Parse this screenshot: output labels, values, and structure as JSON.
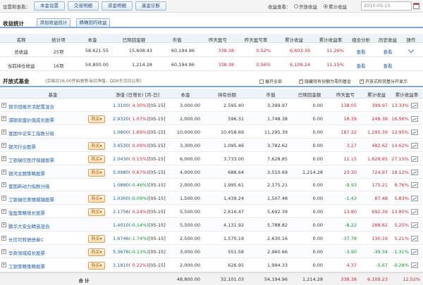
{
  "toolbar": {
    "settings_label": "设置和查看：",
    "buttons": [
      "本金设置",
      "交易明细",
      "资金明细",
      "基金诊断"
    ],
    "view_label": "收益查看：",
    "radio_open": "开放收益",
    "radio_total": "累计收益",
    "date": "2015-05-15"
  },
  "summary": {
    "title": "收益统计",
    "add_button": "添加收益统计",
    "fine_button": "精确到的收益",
    "headers": [
      "名称",
      "统计项",
      "本金",
      "已赎回金额",
      "市值",
      "昨天盈亏",
      "昨天盈亏率",
      "累计收益",
      "累计收益率",
      "组合分析",
      "历史收益",
      "操作"
    ],
    "rows": [
      {
        "name": "总收益",
        "count": "25项",
        "principal": "58,621.55",
        "redeemed": "15,608.43",
        "market": "60,194.96",
        "yday": "338.38",
        "yday_rate": "0.52%",
        "total": "6,603.39",
        "total_rate": "11.26%",
        "analysis": "查看",
        "history": "查看"
      },
      {
        "name": "当前持仓收益",
        "count": "16项",
        "principal": "54,800.00",
        "redeemed": "1,214.28",
        "market": "60,194.96",
        "yday": "338.38",
        "yday_rate": "0.56%",
        "total": "6,109.24",
        "total_rate": "11.15%",
        "analysis": "查看",
        "history": "查看"
      }
    ]
  },
  "funds": {
    "title": "开放式基金",
    "note": "(交易日16:00开始更新当日净值，QDII于次日公布)",
    "opt_expand": "展开全部",
    "opt_hide": "隐藏持有份额为零的基金",
    "opt_open": "开放式和货基分开显示",
    "headers": [
      "基金",
      "净值 (日增长) [月-日]",
      "本金",
      "持有份额",
      "市值",
      "已赎回金额",
      "昨天盈亏",
      "累计收益",
      "累计收益率"
    ],
    "buy_label": "购买",
    "rows": [
      {
        "name": "银华回报灵活配置混合",
        "nav": "1.3100",
        "chg": "( 4.30%)",
        "date": "[05-15]",
        "principal": "3,000.00",
        "shares": "2,595.40",
        "market": "3,399.97",
        "redeemed": "0.00",
        "yday": "138.05",
        "total": "399.97",
        "rate": "13.33%",
        "buy": false
      },
      {
        "name": "浦银安盛价值成长股票",
        "nav": "2.9320",
        "chg": "( 1.07%)",
        "date": "[05-15]",
        "principal": "2,000.00",
        "shares": "596.31",
        "market": "1,748.38",
        "redeemed": "0.00",
        "yday": "18.39",
        "total": "248.38",
        "rate": "16.56%",
        "buy": true
      },
      {
        "name": "富国中证军工指数分级",
        "nav": "1.0800",
        "chg": "( 1.69%)",
        "date": "[05-15]",
        "principal": "10,000.00",
        "shares": "10,458.69",
        "market": "11,295.39",
        "redeemed": "0.00",
        "yday": "187.32",
        "total": "1,295.39",
        "rate": "12.95%",
        "buy": false
      },
      {
        "name": "银河行业股票",
        "nav": "3.4530",
        "chg": "( 0.09%)",
        "date": "[05-15]",
        "principal": "3,300.00",
        "shares": "1,095.46",
        "market": "3,782.62",
        "redeemed": "0.00",
        "yday": "3.27",
        "total": "482.62",
        "rate": "14.62%",
        "buy": true
      },
      {
        "name": "工银瑞信医疗保健股票",
        "nav": "2.0430",
        "chg": "( 0.15%)",
        "date": "[05-15]",
        "principal": "6,000.00",
        "shares": "3,733.00",
        "market": "7,628.85",
        "redeemed": "0.00",
        "yday": "11.15",
        "total": "1,628.85",
        "rate": "27.15%",
        "buy": true
      },
      {
        "name": "银河主题策略股票",
        "nav": "5.0980",
        "chg": "( 0.67%)",
        "date": "[05-15]",
        "principal": "4,000.00",
        "shares": "688.64",
        "market": "3,510.69",
        "redeemed": "1,214.28",
        "yday": "23.30",
        "total": "724.97",
        "rate": "18.12%",
        "buy": true
      },
      {
        "name": "富国新动力指数分级",
        "nav": "1.0880",
        "chg": "(-0.46%)",
        "date": "[05-15]",
        "principal": "2,000.00",
        "shares": "1,995.61",
        "market": "2,175.21",
        "redeemed": "0.00",
        "yday": "-9.93",
        "total": "175.21",
        "rate": "8.76%",
        "buy": false
      },
      {
        "name": "工银瑞信美丽城镇股票",
        "nav": "1.0300",
        "chg": "(-0.09%)",
        "date": "[05-15]",
        "principal": "1,500.00",
        "shares": "1,439.24",
        "market": "1,507.48",
        "redeemed": "0.00",
        "yday": "-1.43",
        "total": "87.48",
        "rate": "5.83%",
        "buy": true
      },
      {
        "name": "宝盈策略增长股票",
        "nav": "2.1756",
        "chg": "( 0.24%)",
        "date": "[05-15]",
        "principal": "5,500.00",
        "shares": "2,616.47",
        "market": "5,692.39",
        "redeemed": "0.00",
        "yday": "13.80",
        "total": "692.39",
        "rate": "13.85%",
        "buy": true
      },
      {
        "name": "鹏华大安全精选混合",
        "nav": "1.4010",
        "chg": "(-0.14%)",
        "date": "[05-15]",
        "principal": "5,500.00",
        "shares": "4,131.92",
        "market": "5,788.82",
        "redeemed": "0.00",
        "yday": "-8.22",
        "total": "288.82",
        "rate": "5.25%",
        "buy": false
      },
      {
        "name": "长信可转债债券C",
        "nav": "1.6746",
        "chg": "(-1.74%)",
        "date": "[05-15]",
        "principal": "2,500.00",
        "shares": "1,570.19",
        "market": "2,630.16",
        "redeemed": "0.00",
        "yday": "-37.78",
        "total": "130.16",
        "rate": "5.21%",
        "buy": true
      },
      {
        "name": "华商领域成长股票",
        "nav": "5.3676",
        "chog": "",
        "chg": "(-0.13%)",
        "date": "[05-15]",
        "principal": "3,000.00",
        "shares": "551.58",
        "market": "2,960.66",
        "redeemed": "0.00",
        "yday": "-3.90",
        "total": "-39.34",
        "rate": "-1.31%",
        "buy": true
      },
      {
        "name": "工银策略策略股票",
        "nav": "3.1810",
        "chg": "( 0.22%)",
        "date": "[05-15]",
        "principal": "2,000.00",
        "shares": "626.95",
        "market": "1,994.33",
        "redeemed": "0.00",
        "yday": "4.37",
        "total": "-5.67",
        "rate": "-0.28%",
        "buy": true
      }
    ],
    "total": {
      "label": "合    计",
      "principal": "48,800.00",
      "shares": "32,101.03",
      "market": "54,194.96",
      "redeemed": "1,214.28",
      "yday": "338.38",
      "total": "6,109.23",
      "rate": "12.52%"
    }
  }
}
